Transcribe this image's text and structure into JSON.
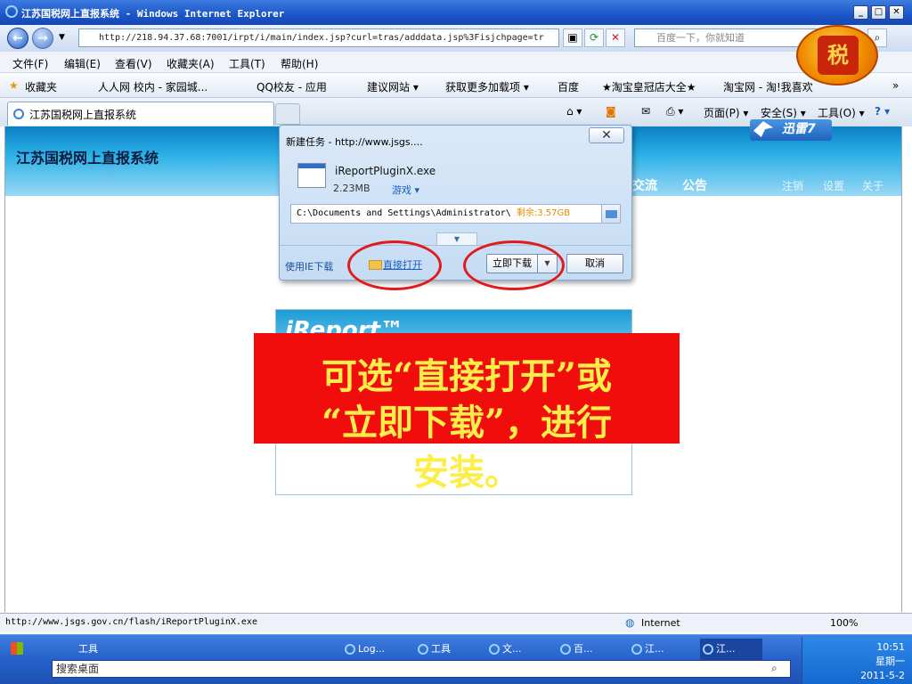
{
  "window": {
    "title": "江苏国税网上直报系统 - Windows Internet Explorer",
    "min": "_",
    "max": "□",
    "close": "✕"
  },
  "address": {
    "url": "http://218.94.37.68:7001/irpt/i/main/index.jsp?curl=tras/adddata.jsp%3Fisjchpage=tr",
    "search_placeholder": "百度一下，你就知道"
  },
  "menu": [
    "文件(F)",
    "编辑(E)",
    "查看(V)",
    "收藏夹(A)",
    "工具(T)",
    "帮助(H)"
  ],
  "favorites": {
    "label": "收藏夹",
    "items": [
      "人人网 校内 - 家园城...",
      "QQ校友 - 应用",
      "建议网站 ▾",
      "获取更多加载项 ▾",
      "百度",
      "★淘宝皇冠店大全★",
      "淘宝网 - 淘!我喜欢"
    ],
    "overflow": "»"
  },
  "tabs": {
    "active": "江苏国税网上直报系统",
    "tools": [
      "页面(P) ▾",
      "安全(S) ▾",
      "工具(O) ▾"
    ]
  },
  "site": {
    "title": "江苏国税网上直报系统",
    "nav": [
      "交流",
      "公告"
    ],
    "util": [
      "注销",
      "设置",
      "关于"
    ],
    "ireport_logo": "iReport™"
  },
  "dialog": {
    "title": "新建任务 - http://www.jsgs....",
    "file_name": "iReportPluginX.exe",
    "file_size": "2.23MB",
    "category": "游戏 ▾",
    "path": "C:\\Documents and Settings\\Administrator\\",
    "free_space": "剩余:3.57GB",
    "ie_option": "使用IE下载",
    "direct_open": "直接打开",
    "download_now": "立即下载",
    "cancel": "取消"
  },
  "thunder": {
    "label": "迅雷7"
  },
  "callout": {
    "line1": "可选“直接打开”或",
    "line2": "“立即下载”，进行",
    "line3": "安装。"
  },
  "status": {
    "url": "http://www.jsgs.gov.cn/flash/iReportPluginX.exe",
    "zone": "Internet",
    "zoom": "100%"
  },
  "taskbar": {
    "tools_label": "工具",
    "items": [
      "Log...",
      "工具",
      "文...",
      "百...",
      "江...",
      "江..."
    ],
    "search_placeholder": "搜索桌面",
    "time": "10:51",
    "weekday": "星期一",
    "date": "2011-5-2"
  },
  "colors": {
    "callout_bg": "#f20d0d",
    "callout_text": "#fcee4a",
    "ring": "#e01b1b"
  }
}
